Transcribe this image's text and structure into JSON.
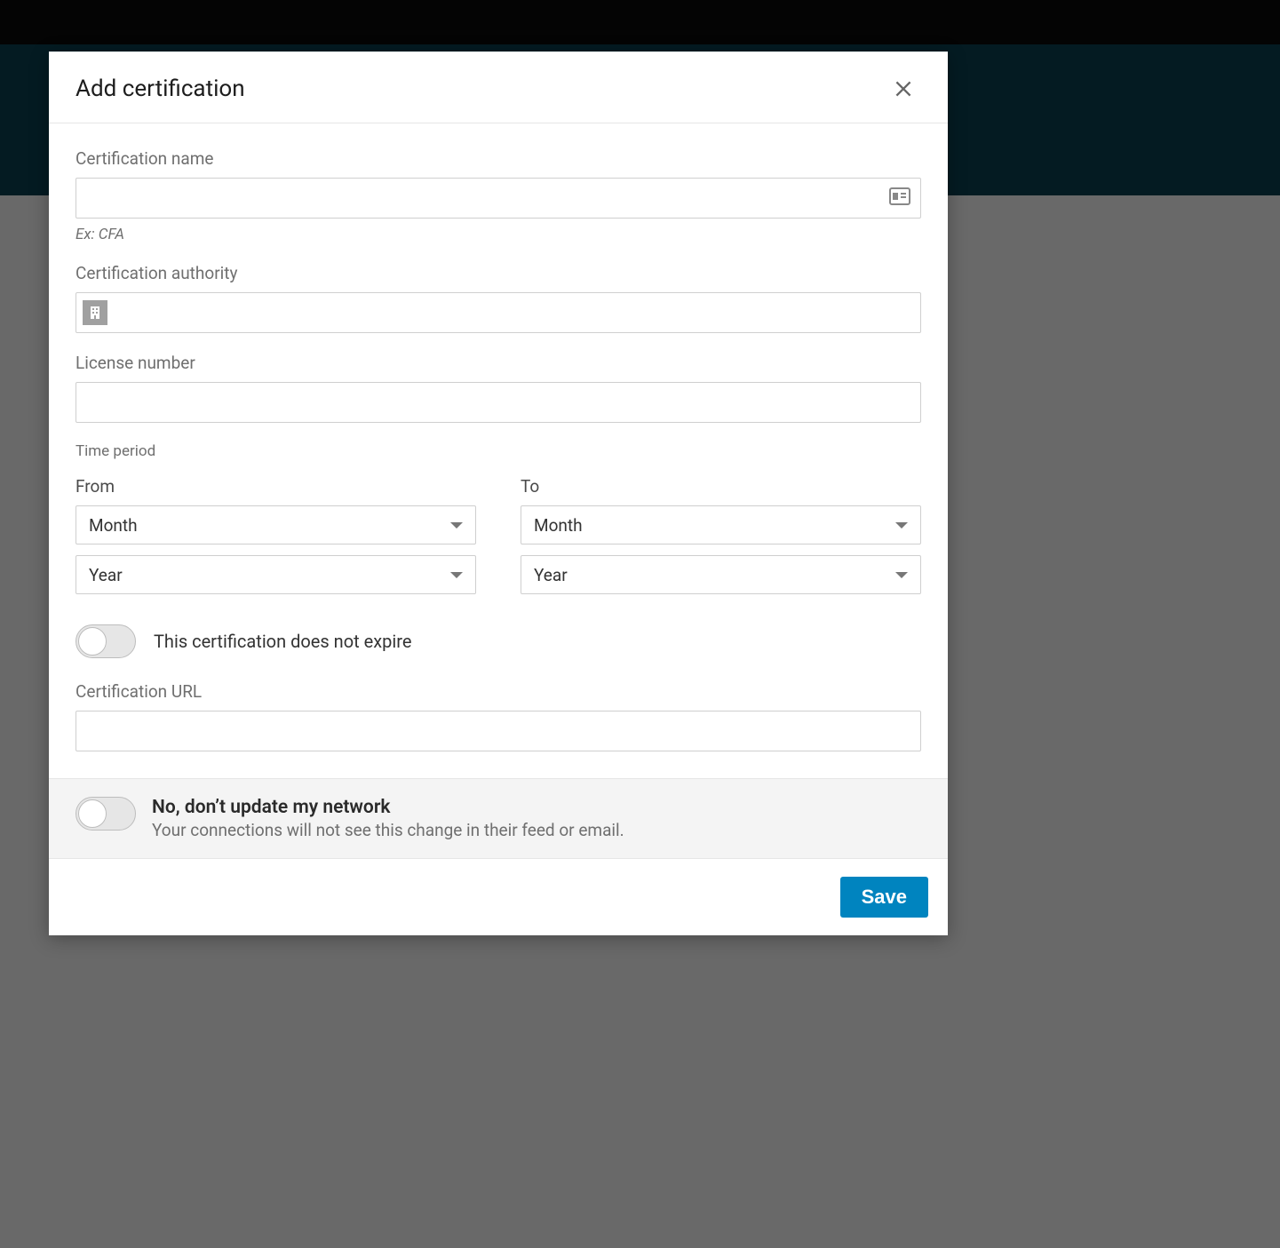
{
  "modal": {
    "title": "Add certification",
    "fields": {
      "certName": {
        "label": "Certification name",
        "value": "",
        "hint": "Ex: CFA"
      },
      "certAuthority": {
        "label": "Certification authority",
        "value": ""
      },
      "licenseNumber": {
        "label": "License number",
        "value": ""
      },
      "certUrl": {
        "label": "Certification URL",
        "value": ""
      }
    },
    "period": {
      "sectionLabel": "Time period",
      "fromLabel": "From",
      "toLabel": "To",
      "fromMonth": "Month",
      "fromYear": "Year",
      "toMonth": "Month",
      "toYear": "Year"
    },
    "noExpire": {
      "label": "This certification does not expire",
      "checked": false
    },
    "network": {
      "head": "No, don’t update my network",
      "sub": "Your connections will not see this change in their feed or email.",
      "checked": false
    },
    "saveLabel": "Save"
  }
}
